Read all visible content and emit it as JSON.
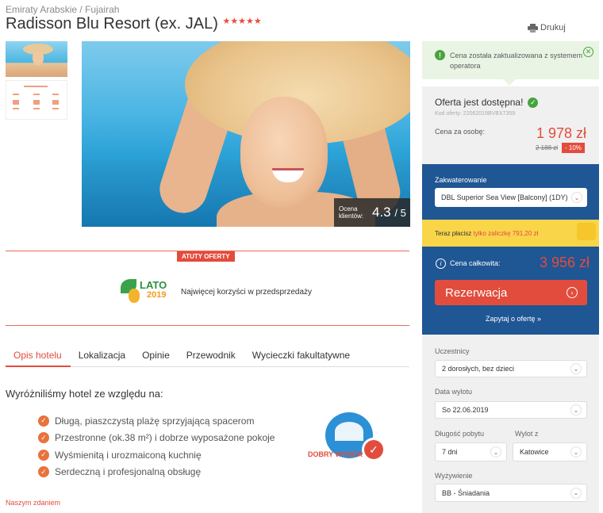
{
  "breadcrumb": {
    "country": "Emiraty Arabskie",
    "separator": "/",
    "region": "Fujairah"
  },
  "hotel": {
    "name": "Radisson Blu Resort (ex. JAL)",
    "stars": "★★★★★"
  },
  "print": {
    "label": "Drukuj",
    "icon": "printer-icon"
  },
  "hero": {
    "rating_label": "Ocena klientów:",
    "rating_value": "4.3",
    "rating_max": "/ 5"
  },
  "atuty": {
    "label": "ATUTY OFERTY"
  },
  "promo": {
    "logo_line1": "LATO",
    "logo_line2": "2019",
    "text": "Najwięcej korzyści w przedsprzedaży"
  },
  "tabs": [
    {
      "label": "Opis hotelu",
      "active": true
    },
    {
      "label": "Lokalizacja"
    },
    {
      "label": "Opinie"
    },
    {
      "label": "Przewodnik"
    },
    {
      "label": "Wycieczki fakultatywne"
    }
  ],
  "features": {
    "title": "Wyróżniliśmy hotel ze względu na:",
    "items": [
      "Długą, piaszczystą plażę sprzyjającą spacerom",
      "Przestronne (ok.38 m²) i dobrze wyposażone pokoje",
      "Wyśmienitą i urozmaiconą kuchnię",
      "Serdeczną i profesjonalną obsługę"
    ],
    "badge_text": "DOBRY WYBÓR"
  },
  "nasz_zdaniem": "Naszym zdaniem",
  "notice": {
    "text": "Cena została zaktualizowana z systemem operatora"
  },
  "offer": {
    "title": "Oferta jest dostępna!",
    "code": "Kod oferty: 22062019BVBX7359",
    "price_label": "Cena za osobę:",
    "price": "1 978 zł",
    "old_price": "2 188 zł",
    "discount": "- 10%"
  },
  "booking": {
    "room_label": "Zakwaterowanie",
    "room_value": "DBL Superior Sea View [Balcony] (1DY)",
    "deposit_text": "Teraz płacisz ",
    "deposit_value": "tylko zaliczkę 791,20 zł",
    "total_label": "Cena całkowita:",
    "total_value": "3 956 zł",
    "reserve_label": "Rezerwacja",
    "ask_label": "Zapytaj o ofertę »"
  },
  "form": {
    "participants_label": "Uczestnicy",
    "participants_value": "2 dorosłych, bez dzieci",
    "date_label": "Data wylotu",
    "date_value": "So 22.06.2019",
    "length_label": "Długość pobytu",
    "length_value": "7 dni",
    "from_label": "Wylot z",
    "from_value": "Katowice",
    "board_label": "Wyżywienie",
    "board_value": "BB - Śniadania"
  },
  "colors": {
    "accent": "#e24c3c",
    "blue": "#1f5694",
    "green": "#47a33f",
    "yellow": "#f9d54a",
    "orange": "#e8733d"
  }
}
